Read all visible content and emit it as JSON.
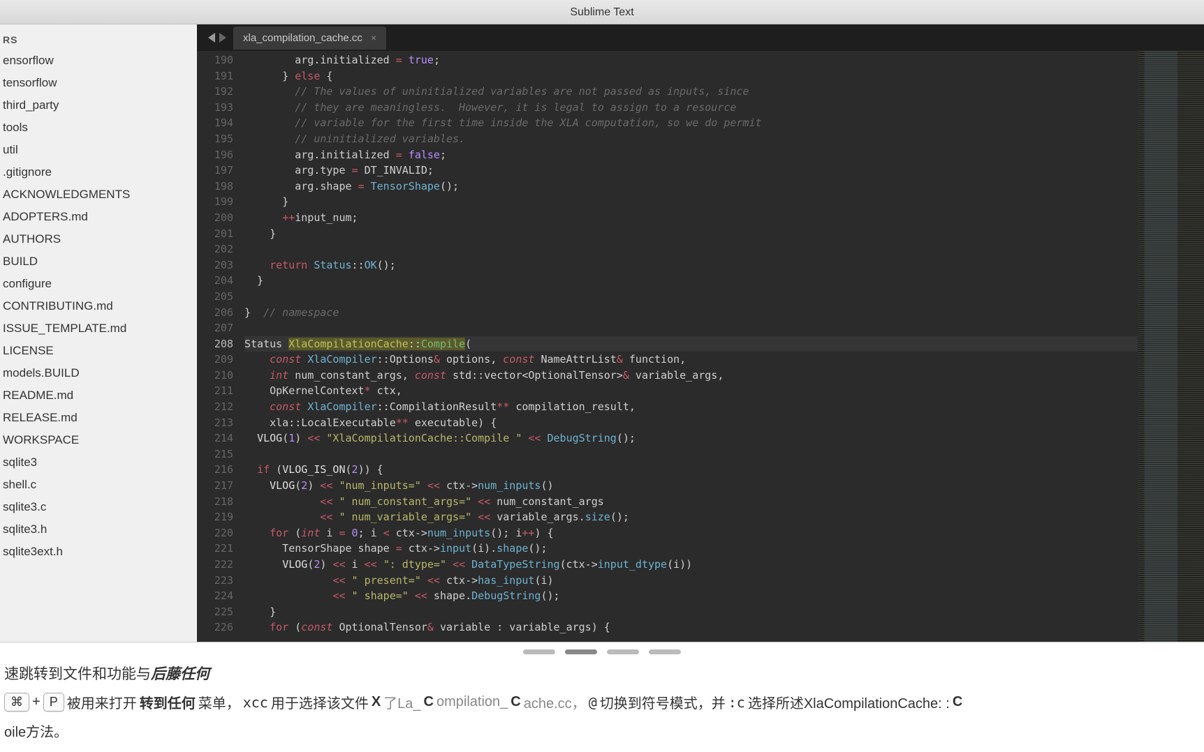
{
  "window": {
    "title": "Sublime Text"
  },
  "sidebar": {
    "heading": "RS",
    "items": [
      "ensorflow",
      "tensorflow",
      "third_party",
      "tools",
      "util",
      ".gitignore",
      "ACKNOWLEDGMENTS",
      "ADOPTERS.md",
      "AUTHORS",
      "BUILD",
      "configure",
      "CONTRIBUTING.md",
      "ISSUE_TEMPLATE.md",
      "LICENSE",
      "models.BUILD",
      "README.md",
      "RELEASE.md",
      "WORKSPACE",
      "sqlite3",
      "shell.c",
      "sqlite3.c",
      "sqlite3.h",
      "sqlite3ext.h"
    ]
  },
  "tabs": {
    "active": {
      "label": "xla_compilation_cache.cc",
      "close": "×"
    }
  },
  "gutter": {
    "start": 190,
    "end": 226,
    "highlight": 208
  },
  "code": {
    "lines": [
      {
        "n": 190,
        "html": "        arg.initialized <span class='c-op'>=</span> <span class='c-bool'>true</span>;"
      },
      {
        "n": 191,
        "html": "      } <span class='c-kw'>else</span> {"
      },
      {
        "n": 192,
        "html": "        <span class='c-cmt'>// The values of uninitialized variables are not passed as inputs, since</span>"
      },
      {
        "n": 193,
        "html": "        <span class='c-cmt'>// they are meaningless.  However, it is legal to assign to a resource</span>"
      },
      {
        "n": 194,
        "html": "        <span class='c-cmt'>// variable for the first time inside the XLA computation, so we do permit</span>"
      },
      {
        "n": 195,
        "html": "        <span class='c-cmt'>// uninitialized variables.</span>"
      },
      {
        "n": 196,
        "html": "        arg.initialized <span class='c-op'>=</span> <span class='c-bool'>false</span>;"
      },
      {
        "n": 197,
        "html": "        arg.type <span class='c-op'>=</span> DT_INVALID;"
      },
      {
        "n": 198,
        "html": "        arg.shape <span class='c-op'>=</span> <span class='c-call'>TensorShape</span>();"
      },
      {
        "n": 199,
        "html": "      }"
      },
      {
        "n": 200,
        "html": "      <span class='c-op'>++</span>input_num;"
      },
      {
        "n": 201,
        "html": "    }"
      },
      {
        "n": 202,
        "html": ""
      },
      {
        "n": 203,
        "html": "    <span class='c-kw'>return</span> <span class='c-type'>Status</span>::<span class='c-call'>OK</span>();"
      },
      {
        "n": 204,
        "html": "  }"
      },
      {
        "n": 205,
        "html": ""
      },
      {
        "n": 206,
        "html": "}  <span class='c-cmt'>// namespace</span>"
      },
      {
        "n": 207,
        "html": ""
      },
      {
        "n": 208,
        "hl": true,
        "html": "Status <span class='c-hl'><span class='c-yellow'>XlaCompilationCache</span>::<span class='c-sym'>Compile</span></span>("
      },
      {
        "n": 209,
        "html": "    <span class='c-kw2'>const</span> <span class='c-type'>XlaCompiler</span>::Options<span class='c-op'>&amp;</span> options, <span class='c-kw2'>const</span> NameAttrList<span class='c-op'>&amp;</span> function,"
      },
      {
        "n": 210,
        "html": "    <span class='c-kw2'>int</span> num_constant_args, <span class='c-kw2'>const</span> std::vector&lt;OptionalTensor&gt;<span class='c-op'>&amp;</span> variable_args,"
      },
      {
        "n": 211,
        "html": "    OpKernelContext<span class='c-op'>*</span> ctx,"
      },
      {
        "n": 212,
        "html": "    <span class='c-kw2'>const</span> <span class='c-type'>XlaCompiler</span>::CompilationResult<span class='c-op'>**</span> compilation_result,"
      },
      {
        "n": 213,
        "html": "    xla::LocalExecutable<span class='c-op'>**</span> executable) {"
      },
      {
        "n": 214,
        "html": "  <span class='c-fn'>VLOG</span>(<span class='c-num'>1</span>) <span class='c-op'>&lt;&lt;</span> <span class='c-str'>\"XlaCompilationCache::Compile \"</span> <span class='c-op'>&lt;&lt;</span> <span class='c-call'>DebugString</span>();"
      },
      {
        "n": 215,
        "html": ""
      },
      {
        "n": 216,
        "html": "  <span class='c-kw'>if</span> (<span class='c-fn'>VLOG_IS_ON</span>(<span class='c-num'>2</span>)) {"
      },
      {
        "n": 217,
        "html": "    <span class='c-fn'>VLOG</span>(<span class='c-num'>2</span>) <span class='c-op'>&lt;&lt;</span> <span class='c-str'>\"num_inputs=\"</span> <span class='c-op'>&lt;&lt;</span> ctx-&gt;<span class='c-call'>num_inputs</span>()"
      },
      {
        "n": 218,
        "html": "            <span class='c-op'>&lt;&lt;</span> <span class='c-str'>\" num_constant_args=\"</span> <span class='c-op'>&lt;&lt;</span> num_constant_args"
      },
      {
        "n": 219,
        "html": "            <span class='c-op'>&lt;&lt;</span> <span class='c-str'>\" num_variable_args=\"</span> <span class='c-op'>&lt;&lt;</span> variable_args.<span class='c-call'>size</span>();"
      },
      {
        "n": 220,
        "html": "    <span class='c-kw'>for</span> (<span class='c-kw2'>int</span> i <span class='c-op'>=</span> <span class='c-num'>0</span>; i <span class='c-op'>&lt;</span> ctx-&gt;<span class='c-call'>num_inputs</span>(); i<span class='c-op'>++</span>) {"
      },
      {
        "n": 221,
        "html": "      TensorShape shape <span class='c-op'>=</span> ctx-&gt;<span class='c-call'>input</span>(i).<span class='c-call'>shape</span>();"
      },
      {
        "n": 222,
        "html": "      <span class='c-fn'>VLOG</span>(<span class='c-num'>2</span>) <span class='c-op'>&lt;&lt;</span> i <span class='c-op'>&lt;&lt;</span> <span class='c-str'>\": dtype=\"</span> <span class='c-op'>&lt;&lt;</span> <span class='c-call'>DataTypeString</span>(ctx-&gt;<span class='c-call'>input_dtype</span>(i))"
      },
      {
        "n": 223,
        "html": "              <span class='c-op'>&lt;&lt;</span> <span class='c-str'>\" present=\"</span> <span class='c-op'>&lt;&lt;</span> ctx-&gt;<span class='c-call'>has_input</span>(i)"
      },
      {
        "n": 224,
        "html": "              <span class='c-op'>&lt;&lt;</span> <span class='c-str'>\" shape=\"</span> <span class='c-op'>&lt;&lt;</span> shape.<span class='c-call'>DebugString</span>();"
      },
      {
        "n": 225,
        "html": "    }"
      },
      {
        "n": 226,
        "html": "    <span class='c-kw'>for</span> (<span class='c-kw2'>const</span> OptionalTensor<span class='c-op'>&amp;</span> variable : variable_args) {"
      }
    ]
  },
  "bottom": {
    "line1_a": "速跳转到文件和功能与",
    "line1_b": "后藤任何",
    "kbd_cmd": "⌘",
    "kbd_plus": "+",
    "kbd_p": "P",
    "seg1": "被用来打开",
    "seg1b": "转到任何",
    "seg1c": "菜单，",
    "mono_xcc": "xcc",
    "seg2": " 用于选择该文件",
    "x_bold": "X",
    "seg2b": "了La_ ",
    "c_bold1": "C",
    "seg2c": " ompilation_ ",
    "c_bold2": "C",
    "seg2d": " ache.cc，",
    "at": "@",
    "seg3": " 切换到符号模式，并 ",
    "colon_c": ":c",
    "seg4": " 选择所述XlaCompilationCache: : ",
    "c_bold3": "C",
    "line3": "oile方法。"
  }
}
